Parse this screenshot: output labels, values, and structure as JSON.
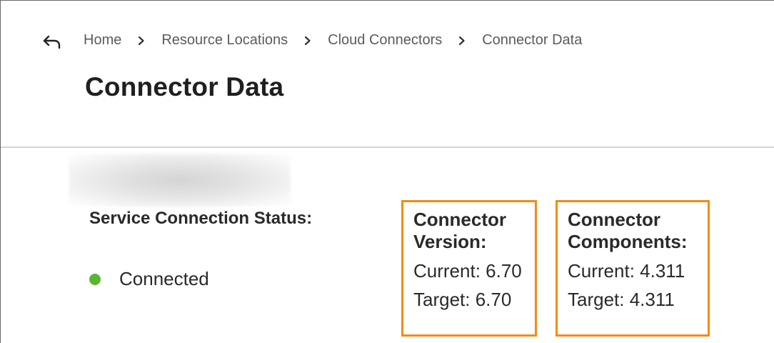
{
  "navigation": {
    "back_icon": "back-arrow-icon",
    "breadcrumb": [
      {
        "label": "Home"
      },
      {
        "label": "Resource Locations"
      },
      {
        "label": "Cloud Connectors"
      },
      {
        "label": "Connector Data"
      }
    ],
    "separator_icon": "chevron-right-icon"
  },
  "page": {
    "title": "Connector Data"
  },
  "status": {
    "label": "Service Connection Status:",
    "value": "Connected",
    "color": "#5cb531"
  },
  "connector_version": {
    "title_line1": "Connector",
    "title_line2": "Version:",
    "current": "Current: 6.70",
    "target": "Target: 6.70"
  },
  "connector_components": {
    "title_line1": "Connector",
    "title_line2": "Components:",
    "current": "Current: 4.311",
    "target": "Target: 4.311"
  },
  "colors": {
    "highlight_border": "#f28c14",
    "divider": "#d6d6d6"
  }
}
